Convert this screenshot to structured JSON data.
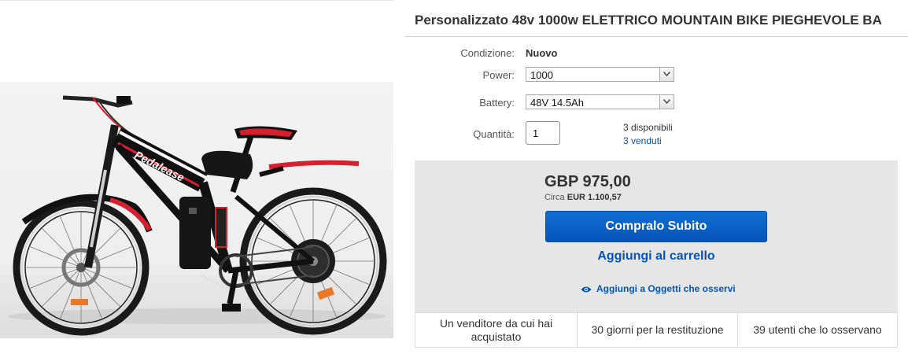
{
  "listing": {
    "title": "Personalizzato 48v 1000w ELETTRICO MOUNTAIN BIKE PIEGHEVOLE BA"
  },
  "image": {
    "frame_brand": "Pedalease",
    "frame_brand_small": "Pedalease"
  },
  "details": {
    "condition_label": "Condizione:",
    "condition_value": "Nuovo",
    "power_label": "Power:",
    "power_value": "1000",
    "battery_label": "Battery:",
    "battery_value": "48V 14.5Ah",
    "quantity_label": "Quantità:",
    "quantity_value": "1",
    "available": "3 disponibili",
    "sold": "3 venduti"
  },
  "buy": {
    "price": "GBP 975,00",
    "approx_prefix": "Circa",
    "approx_value": "EUR 1.100,57",
    "buy_now_label": "Compralo Subito",
    "add_to_cart_label": "Aggiungi al carrello",
    "watch_label": "Aggiungi a Oggetti che osservi"
  },
  "stats": [
    "Un venditore da cui hai acquistato",
    "30 giorni per la restituzione",
    "39 utenti che lo osservano"
  ],
  "colors": {
    "link": "#0654ba",
    "button": "#0654ba",
    "box_bg": "#e6e6e6",
    "bike_red": "#d6202f"
  },
  "icons": {
    "select_arrow": "chevron-down-icon",
    "watch": "eye-icon"
  }
}
